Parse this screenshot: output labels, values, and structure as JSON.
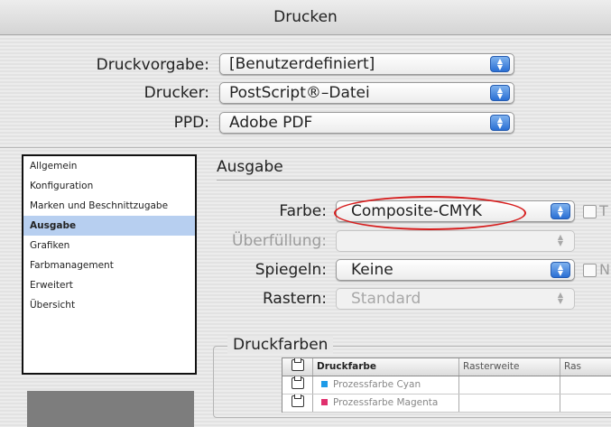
{
  "window": {
    "title": "Drucken"
  },
  "top_fields": {
    "druckvorgabe": {
      "label": "Druckvorgabe:",
      "value": "[Benutzerdefiniert]"
    },
    "drucker": {
      "label": "Drucker:",
      "value": "PostScript®–Datei"
    },
    "ppd": {
      "label": "PPD:",
      "value": "Adobe PDF"
    }
  },
  "sidebar": {
    "items": [
      {
        "label": "Allgemein"
      },
      {
        "label": "Konfiguration"
      },
      {
        "label": "Marken und Beschnittzugabe"
      },
      {
        "label": "Ausgabe",
        "selected": true
      },
      {
        "label": "Grafiken"
      },
      {
        "label": "Farbmanagement"
      },
      {
        "label": "Erweitert"
      },
      {
        "label": "Übersicht"
      }
    ]
  },
  "section": {
    "title": "Ausgabe",
    "farbe": {
      "label": "Farbe:",
      "value": "Composite-CMYK",
      "check_label": "T"
    },
    "ueberfuellung": {
      "label": "Überfüllung:",
      "value": ""
    },
    "spiegeln": {
      "label": "Spiegeln:",
      "value": "Keine",
      "check_label": "N"
    },
    "rastern": {
      "label": "Rastern:",
      "value": "Standard"
    }
  },
  "druckfarben": {
    "title": "Druckfarben",
    "columns": [
      "Druckfarbe",
      "Rasterweite",
      "Ras"
    ],
    "rows": [
      {
        "name": "Prozessfarbe Cyan",
        "color": "#1e9be8"
      },
      {
        "name": "Prozessfarbe Magenta",
        "color": "#e0306e"
      }
    ]
  },
  "colors": {
    "highlight": "#d61d1d",
    "selection": "#b7cff0",
    "popup_arrows": "#2a6fd4"
  },
  "icons": {
    "printer": "printer-icon",
    "popup_arrows": "up-down-arrows-icon"
  }
}
